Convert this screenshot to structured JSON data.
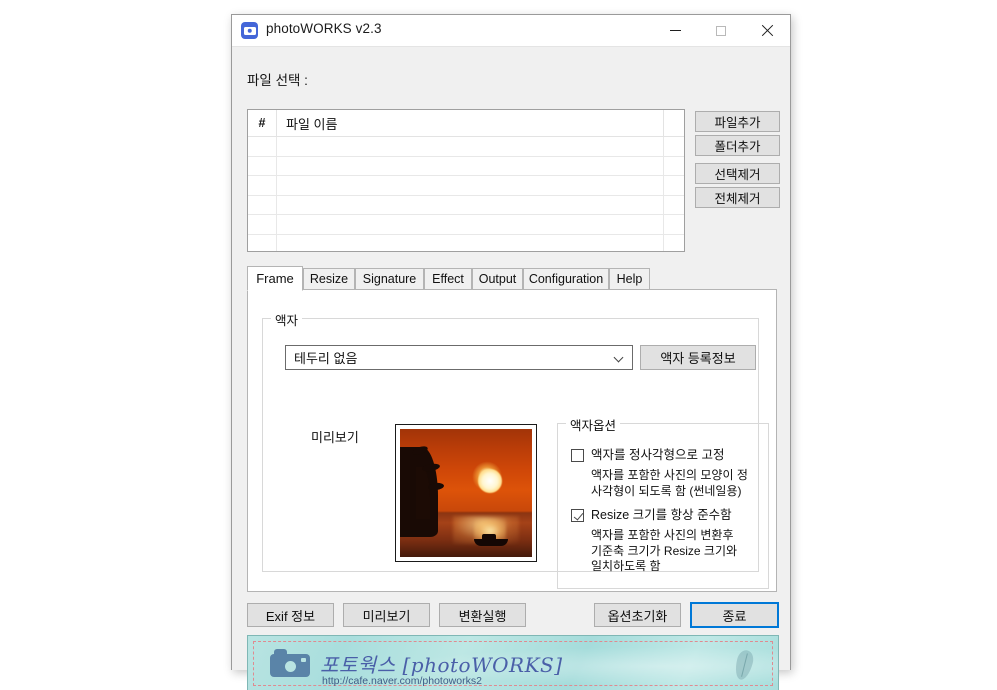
{
  "window": {
    "title": "photoWORKS v2.3",
    "icon": "camera-app-icon",
    "controls": {
      "minimize": "–",
      "maximize": "□",
      "close": "✕"
    }
  },
  "file_section": {
    "label": "파일 선택 :",
    "columns": [
      "#",
      "파일 이름"
    ],
    "rows": [],
    "buttons": [
      "파일추가",
      "폴더추가",
      "선택제거",
      "전체제거"
    ]
  },
  "tabs": [
    {
      "label": "Frame",
      "active": true
    },
    {
      "label": "Resize",
      "active": false
    },
    {
      "label": "Signature",
      "active": false
    },
    {
      "label": "Effect",
      "active": false
    },
    {
      "label": "Output",
      "active": false
    },
    {
      "label": "Configuration",
      "active": false
    },
    {
      "label": "Help",
      "active": false
    }
  ],
  "frame_tab": {
    "group_label": "액자",
    "frame_select": {
      "value": "테두리 없음",
      "options": [
        "테두리 없음"
      ]
    },
    "frame_info_button": "액자 등록정보",
    "preview_label": "미리보기",
    "preview_image_alt": "sunset-photo-preview",
    "options_group_label": "액자옵션",
    "options": [
      {
        "label": "액자를 정사각형으로 고정",
        "checked": false,
        "description": "액자를 포함한 사진의 모양이 정\n사각형이 되도록 함 (썬네일용)"
      },
      {
        "label": "Resize 크기를 항상 준수함",
        "checked": true,
        "description": "액자를 포함한 사진의 변환후\n기준축 크기가 Resize 크기와\n일치하도록 함"
      }
    ]
  },
  "bottom_buttons": {
    "exif": "Exif 정보",
    "preview": "미리보기",
    "convert": "변환실행",
    "reset": "옵션초기화",
    "exit": "종료"
  },
  "banner": {
    "title": "포토웍스 [photoWORKS]",
    "url": "http://cafe.naver.com/photoworks2",
    "icon": "camera-icon",
    "decoration": "leaf-icon"
  },
  "colors": {
    "accent": "#0078d7",
    "window_bg": "#f0f0f0",
    "banner_bg": "#b1e2e0",
    "banner_text": "#4a5fa8",
    "banner_dash": "#e08a90"
  }
}
